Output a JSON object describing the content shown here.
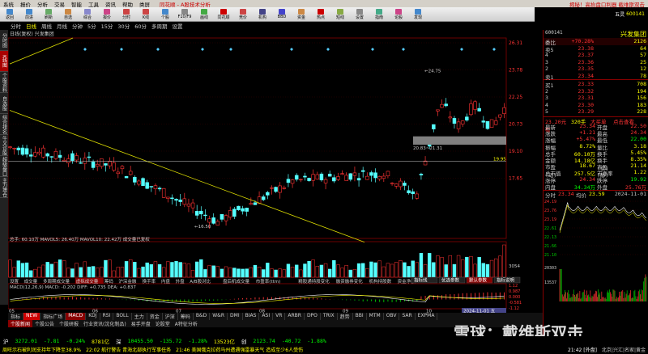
{
  "menubar": {
    "items": [
      "系统",
      "报价",
      "分析",
      "交易",
      "智能",
      "工具",
      "资讯",
      "帮助",
      "类屏"
    ],
    "app_title": "同花顺 - A股技术分析",
    "right": "揭秘！高抬盘口利器  截维斯双击"
  },
  "toolbar": {
    "buttons": [
      {
        "label": "返回",
        "color": "#48c"
      },
      {
        "label": "前进",
        "color": "#48c"
      },
      {
        "label": "刷新",
        "color": "#6a6"
      },
      {
        "label": "自选",
        "color": "#c84"
      },
      {
        "label": "综合",
        "color": "#88c"
      },
      {
        "label": "报价",
        "color": "#c48"
      },
      {
        "label": "分时",
        "color": "#c44"
      },
      {
        "label": "K线",
        "color": "#c44"
      },
      {
        "label": "个股",
        "color": "#48c"
      },
      {
        "label": "F10/F9",
        "color": "#888"
      },
      {
        "label": "画线",
        "color": "#4a4"
      },
      {
        "label": "同花顺",
        "color": "#c00"
      },
      {
        "label": "竞价",
        "color": "#c44"
      },
      {
        "label": "机构",
        "color": "#448"
      },
      {
        "label": "BBD",
        "color": "#44c"
      },
      {
        "label": "资金",
        "color": "#c84"
      },
      {
        "label": "热点",
        "color": "#c00"
      },
      {
        "label": "短线",
        "color": "#8a4"
      },
      {
        "label": "设置",
        "color": "#888"
      },
      {
        "label": "指南",
        "color": "#4a8"
      },
      {
        "label": "论股",
        "color": "#c48"
      },
      {
        "label": "发现",
        "color": "#48c"
      }
    ],
    "right_text": "五灵",
    "stock_code": "600141"
  },
  "periodbar": {
    "items": [
      "分时",
      "日线",
      "周线",
      "月线",
      "分钟",
      "5分",
      "15分",
      "30分",
      "60分",
      "多周期",
      "设置"
    ],
    "active": 1
  },
  "leftbar": [
    "分时图",
    "K线图",
    "个股资料",
    "自选股",
    "综合排名",
    "牛叉诊股",
    "超级盘口",
    "主力增仓"
  ],
  "chart_title": "日线(复权) 兴发集团",
  "main_chart": {
    "price_labels": [
      "26.31",
      "23.78",
      "22.25",
      "20.73",
      "19.10",
      "17.65"
    ],
    "annotations": {
      "high": "24.75",
      "low": "16.50",
      "range": "20.83~21.31",
      "current": "19.95"
    }
  },
  "volume_chart": {
    "header": "总手: 60.10万 MAVOL5: 26.40万 MAVOL10: 22.42万 成交量已复权",
    "labels": [
      "3054"
    ]
  },
  "tabs_mid": [
    "设置",
    "成交量",
    "多周期成交量",
    "虚拟成交量",
    "筹码",
    "沪深金融",
    "换手率",
    "内盘",
    "外盘",
    "A/B股对比",
    "盘后机成交量",
    "市盈率(ttm)",
    "精股通持股变化",
    "融资融券变化",
    "机构持股数",
    "资金净额"
  ],
  "tabs_mid_active": 3,
  "macd": {
    "header": "MACD(12,26,9) MACD: -0.202 DIFF: +0.735 DEA: +0.837",
    "right_labels": [
      "1.12",
      "0.987",
      "0.000",
      "-0.581",
      "-1.12"
    ],
    "overlay_buttons": [
      "指标线",
      "优选参数",
      "默认参数",
      "指标说明"
    ]
  },
  "date_axis": [
    "05",
    "06",
    "07",
    "08",
    "09",
    "10"
  ],
  "date_current": "2024-11-01 五",
  "indicator_tabs": [
    "指标",
    "NEW",
    "指标广场",
    "MACD",
    "KDJ",
    "RSI",
    "BOLL",
    "主力",
    "资金",
    "沪深",
    "筹码",
    "B&D",
    "W&R",
    "DMI",
    "BIAS",
    "ASI",
    "VR",
    "ARBR",
    "DPO",
    "TRIX",
    "趋势",
    "BBI",
    "MTM",
    "OBV",
    "SAR",
    "EXPMA"
  ],
  "indicator_active": 3,
  "news_tabs": [
    "个股新闻",
    "个股公告",
    "个股研报",
    "行业资讯(沈化制品)",
    "易手开盘",
    "论股堂",
    "A特征分析"
  ],
  "news_active": 0,
  "right_panel": {
    "name": "兴发集团",
    "code": "600141",
    "weibi": {
      "label": "委比",
      "pct": "+70.28%",
      "vol": "2126"
    },
    "asks": [
      {
        "l": "卖5",
        "p": "23.38",
        "v": "64"
      },
      {
        "l": "4",
        "p": "23.37",
        "v": "57"
      },
      {
        "l": "3",
        "p": "23.36",
        "v": "25"
      },
      {
        "l": "2",
        "p": "23.35",
        "v": "12"
      },
      {
        "l": "卖1",
        "p": "23.34",
        "v": "78"
      }
    ],
    "bids": [
      {
        "l": "买1",
        "p": "23.33",
        "v": "708"
      },
      {
        "l": "2",
        "p": "23.32",
        "v": "194"
      },
      {
        "l": "3",
        "p": "23.31",
        "v": "156"
      },
      {
        "l": "4",
        "p": "23.30",
        "v": "183"
      },
      {
        "l": "5",
        "p": "23.29",
        "v": "228"
      }
    ],
    "big_order": {
      "a": "23.20元有",
      "b": "320手",
      "c": "大买单",
      "d": "点击查看"
    },
    "stats": [
      {
        "a": "最新",
        "b": "23.34",
        "c": "开盘",
        "d": "22.50",
        "bc": "red",
        "dc": "red"
      },
      {
        "a": "涨跌",
        "b": "+1.21",
        "c": "最高",
        "d": "24.34",
        "bc": "red",
        "dc": "red"
      },
      {
        "a": "涨幅",
        "b": "+5.47%",
        "c": "最低",
        "d": "22.00",
        "bc": "red",
        "dc": "green"
      },
      {
        "a": "振幅",
        "b": "8.72%",
        "c": "量比",
        "d": "3.18",
        "bc": "yellow",
        "dc": "yellow"
      },
      {
        "a": "总手",
        "b": "60.10万",
        "c": "换手",
        "d": "5.45%",
        "bc": "yellow",
        "dc": "yellow"
      },
      {
        "a": "金额",
        "b": "14.18亿",
        "c": "换手(实)",
        "d": "8.35%",
        "bc": "yellow",
        "dc": "yellow"
      },
      {
        "a": "市盈(动)",
        "b": "18.67",
        "c": "市盈(静)",
        "d": "21.14",
        "bc": "yellow",
        "dc": "yellow"
      },
      {
        "a": "总市值",
        "b": "257.5亿",
        "c": "市净率",
        "d": "1.22",
        "bc": "yellow",
        "dc": "yellow"
      },
      {
        "a": "涨停",
        "b": "24.34",
        "c": "跌停",
        "d": "19.92",
        "bc": "red",
        "dc": "green"
      },
      {
        "a": "内盘",
        "b": "34.34万",
        "c": "外盘",
        "d": "25.76万",
        "bc": "green",
        "dc": "red"
      }
    ],
    "mini_header": {
      "l": "分时",
      "a": "23.34",
      "b": "均价",
      "c": "23.59",
      "date": "2024-11-01"
    },
    "mini_prices": [
      "24.19",
      "23.76",
      "23.19",
      "22.61",
      "22.13",
      "21.66",
      "21.10"
    ],
    "mini_vol_labels": [
      "20303",
      "13537"
    ]
  },
  "ticker": [
    {
      "t": "沪",
      "c": "white"
    },
    {
      "t": "3272.01",
      "c": "green"
    },
    {
      "t": "-7.81",
      "c": "green"
    },
    {
      "t": "-0.24%",
      "c": "green"
    },
    {
      "t": "8781亿",
      "c": "yellow"
    },
    {
      "t": "深",
      "c": "white"
    },
    {
      "t": "10455.50",
      "c": "green"
    },
    {
      "t": "-135.72",
      "c": "green"
    },
    {
      "t": "-1.28%",
      "c": "green"
    },
    {
      "t": "13523亿",
      "c": "yellow"
    },
    {
      "t": "创",
      "c": "white"
    },
    {
      "t": "2123.74",
      "c": "green"
    },
    {
      "t": "-40.72",
      "c": "green"
    },
    {
      "t": "-1.88%",
      "c": "green"
    }
  ],
  "statusbar": {
    "left": "周旺示石被利润支持年下降至38.9%",
    "mid1": "22:02 航行警告 青海北部执行军事任务",
    "mid2": "21:46 美国俄克拉荷马州遭遇强雷暴天气 造成至少6人受伤",
    "time": "21:42 [外盘]",
    "right": "北京|兴汇|名家|黄金"
  },
  "watermark": "雪球：戴维斯双击"
}
